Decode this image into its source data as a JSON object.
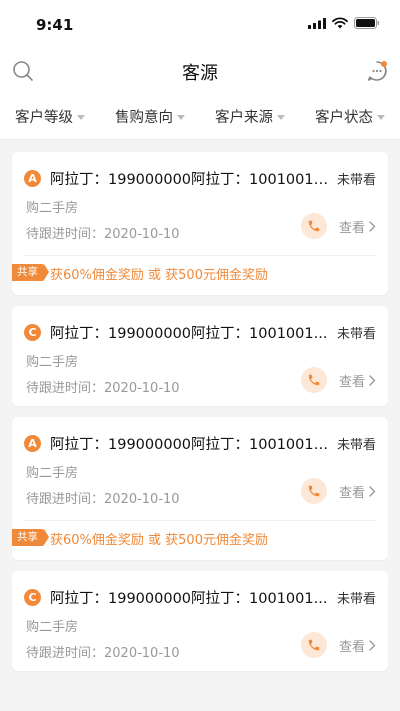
{
  "status_bar": {
    "time": "9:41"
  },
  "nav": {
    "title": "客源"
  },
  "filters": [
    "客户等级",
    "售购意向",
    "客户来源",
    "客户状态"
  ],
  "view_label": "查看",
  "cards": [
    {
      "grade": "A",
      "title": "阿拉丁：199000000阿拉丁：10010010...",
      "status": "未带看",
      "intent": "购二手房",
      "follow": "待跟进时间：2020-10-10",
      "share_badge": "共享",
      "reward": "获60%佣金奖励 或 获500元佣金奖励"
    },
    {
      "grade": "C",
      "title": "阿拉丁：199000000阿拉丁：1001001...",
      "status": "未带看",
      "intent": "购二手房",
      "follow": "待跟进时间：2020-10-10"
    },
    {
      "grade": "A",
      "title": "阿拉丁：199000000阿拉丁：10010010...",
      "status": "未带看",
      "intent": "购二手房",
      "follow": "待跟进时间：2020-10-10",
      "share_badge": "共享",
      "reward": "获60%佣金奖励 或 获500元佣金奖励"
    },
    {
      "grade": "C",
      "title": "阿拉丁：199000000阿拉丁：1001001...",
      "status": "未带看",
      "intent": "购二手房",
      "follow": "待跟进时间：2020-10-10"
    }
  ],
  "colors": {
    "accent": "#f08a3a",
    "accent_light": "#fde7d6"
  }
}
